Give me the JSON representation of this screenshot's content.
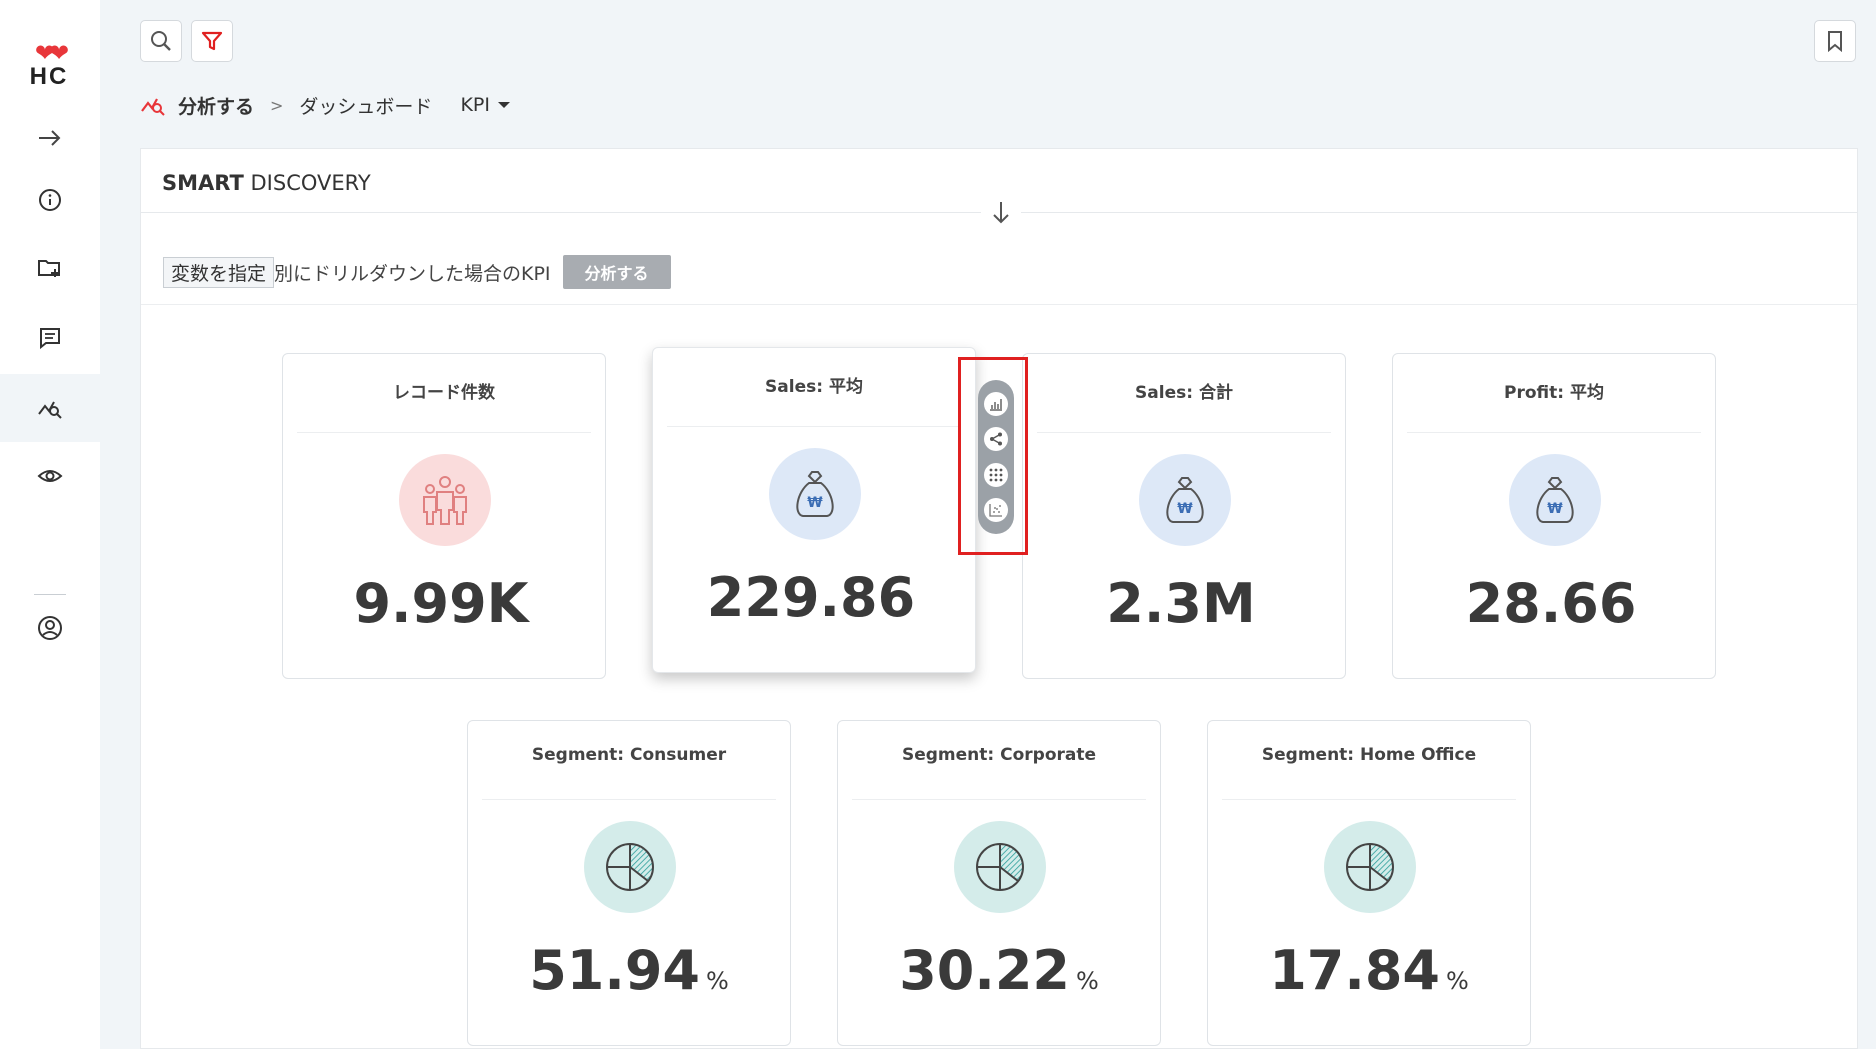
{
  "logo": {
    "hearts": "❤❤",
    "text": "HC"
  },
  "sidebar": {
    "items": [
      {
        "name": "expand-arrow-icon",
        "active": false
      },
      {
        "name": "info-icon",
        "active": false
      },
      {
        "name": "folder-add-icon",
        "active": false
      },
      {
        "name": "comment-icon",
        "active": false
      },
      {
        "name": "analyze-icon",
        "active": true
      },
      {
        "name": "eye-icon",
        "active": false
      },
      {
        "name": "user-account-icon",
        "active": false
      }
    ]
  },
  "toolbar": {
    "search_icon": "search-icon",
    "filter_icon": "filter-icon",
    "bookmark_icon": "bookmark-icon"
  },
  "breadcrumb": {
    "root": "分析する",
    "separator": ">",
    "current": "ダッシュボード",
    "dropdown": "KPI"
  },
  "panel": {
    "title_bold": "SMART",
    "title_rest": " DISCOVERY",
    "variable_tag": "変数を指定",
    "drill_text": "別にドリルダウンした場合のKPI",
    "analyze_button": "分析する"
  },
  "cards": [
    {
      "title": "レコード件数",
      "value": "9.99K",
      "unit": "",
      "icon": "people-icon",
      "icon_color": "red"
    },
    {
      "title": "Sales:  平均",
      "value": "229.86",
      "unit": "",
      "icon": "money-bag-icon",
      "icon_color": "blue"
    },
    {
      "title": "Sales:  合計",
      "value": "2.3M",
      "unit": "",
      "icon": "money-bag-icon",
      "icon_color": "blue"
    },
    {
      "title": "Profit:  平均",
      "value": "28.66",
      "unit": "",
      "icon": "money-bag-icon",
      "icon_color": "blue"
    },
    {
      "title": "Segment:  Consumer",
      "value": "51.94",
      "unit": "%",
      "icon": "pie-chart-icon",
      "icon_color": "teal"
    },
    {
      "title": "Segment:  Corporate",
      "value": "30.22",
      "unit": "%",
      "icon": "pie-chart-icon",
      "icon_color": "teal"
    },
    {
      "title": "Segment:  Home Office",
      "value": "17.84",
      "unit": "%",
      "icon": "pie-chart-icon",
      "icon_color": "teal"
    }
  ],
  "card_tools": [
    "bar-chart-icon",
    "share-icon",
    "grid-dots-icon",
    "scatter-chart-icon"
  ],
  "colors": {
    "accent_red": "#e8363a",
    "highlight_frame": "#e02020",
    "card_value": "#3a3a3a"
  }
}
